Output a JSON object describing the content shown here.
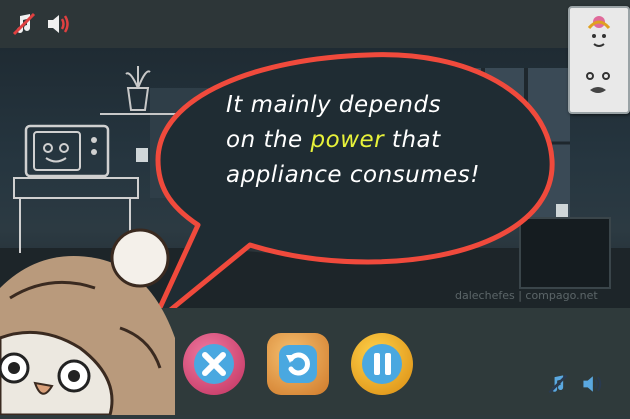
{
  "game": {
    "dialogue": {
      "line1": "It mainly depends",
      "line2_a": "on the ",
      "line2_highlight": "power",
      "line2_b": " that",
      "line3": "appliance consumes!"
    },
    "watermark": "dalechefes | compago.net",
    "controls": {
      "close": "close-icon",
      "restart": "restart-icon",
      "pause": "pause-icon"
    },
    "top_icons": [
      "music-muted-icon",
      "speaker-icon"
    ],
    "bottom_icons": [
      "music-muted-icon",
      "speaker-icon"
    ]
  },
  "colors": {
    "bubble_fill": "#1f2c33",
    "bubble_stroke": "#f04a3c",
    "highlight": "#e8f23a",
    "close_button": "#e0487a",
    "restart_button": "#e6a23c",
    "pause_button": "#f0b020"
  }
}
